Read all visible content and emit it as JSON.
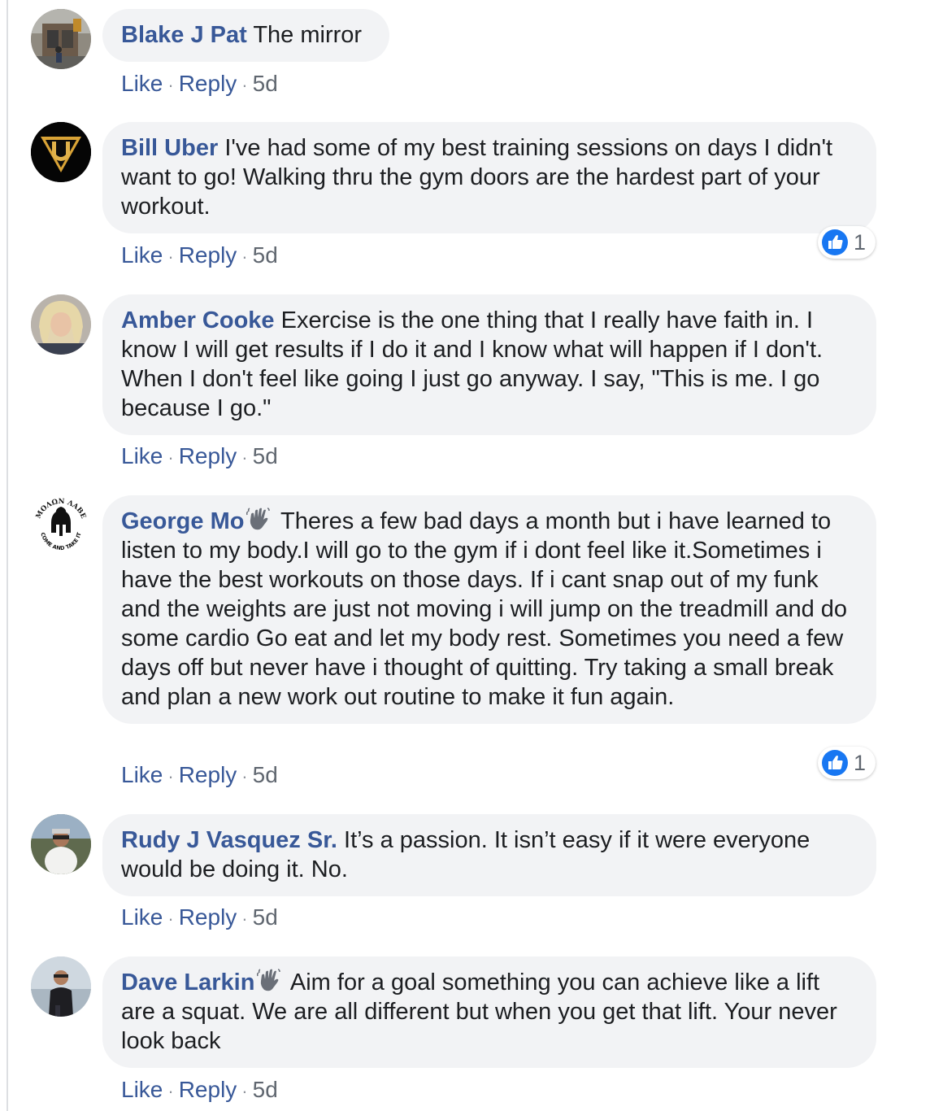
{
  "actions": {
    "like": "Like",
    "reply": "Reply",
    "separator": "·"
  },
  "colors": {
    "author": "#385898",
    "bubble": "#f2f3f5",
    "like_badge": "#1877f2"
  },
  "comments": [
    {
      "author": "Blake J Pat",
      "text": "The mirror",
      "time": "5d",
      "avatar_icon": "storefront-photo-avatar"
    },
    {
      "author": "Bill Uber",
      "text": "I've had some of my best training sessions on days I didn't want to go! Walking thru the gym doors are the hardest part of your workout.",
      "time": "5d",
      "reactions": "1",
      "avatar_icon": "shield-logo-avatar"
    },
    {
      "author": "Amber Cooke",
      "text": "Exercise is the one thing that I really have faith in. I know I will get results if I do it and I know what will happen if I don't. When I don't feel like going I just go anyway. I say, \"This is me. I go because I go.\"",
      "time": "5d",
      "avatar_icon": "portrait-photo-avatar"
    },
    {
      "author": "George Mo",
      "text": "Theres a few bad days a month but i have learned to listen to my body.I will go to the gym if i dont feel like it.Sometimes i have the best workouts on those days. If i cant snap out of my funk and the weights are just not moving i will jump on the treadmill and do some cardio Go eat and let my body rest. Sometimes you need a few days off but never have i thought of quitting. Try taking a small break and plan a new work out routine to make it fun again.",
      "time": "5d",
      "reactions": "1",
      "avatar_icon": "spartan-helmet-avatar",
      "avatar_text": {
        "top": "ΜΟΛΩΝ ΛΑΒΕ",
        "bottom": "COME AND TAKE IT"
      }
    },
    {
      "author": "Rudy J Vasquez Sr.",
      "text": "It’s a passion. It isn’t easy if it were everyone would be doing it. No.",
      "time": "5d",
      "avatar_icon": "person-photo-avatar"
    },
    {
      "author": "Dave Larkin",
      "text": "Aim for a goal something you can achieve like a lift are a squat. We are all different but when you get that lift. Your never look back",
      "time": "5d",
      "avatar_icon": "person-photo-avatar"
    }
  ]
}
